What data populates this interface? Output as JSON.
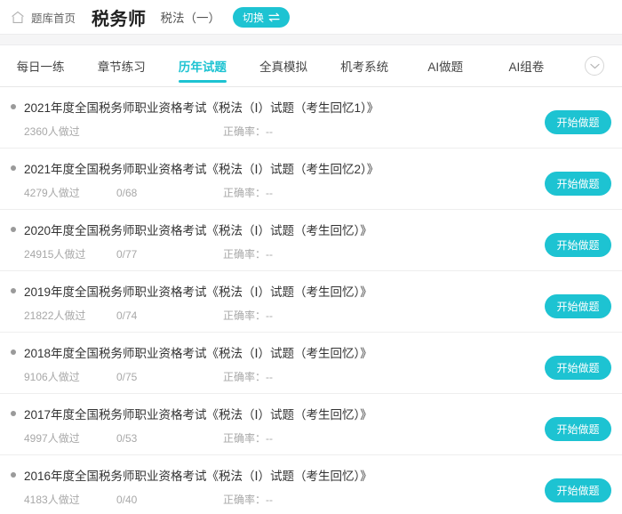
{
  "header": {
    "home_icon": "home-icon",
    "breadcrumb_home": "题库首页",
    "exam_title": "税务师",
    "subject_name": "税法（一）",
    "switch_label": "切换",
    "switch_icon": "swap-horizontal-icon"
  },
  "tabs": {
    "items": [
      {
        "label": "每日一练",
        "active": false
      },
      {
        "label": "章节练习",
        "active": false
      },
      {
        "label": "历年试题",
        "active": true
      },
      {
        "label": "全真模拟",
        "active": false
      },
      {
        "label": "机考系统",
        "active": false
      },
      {
        "label": "AI做题",
        "active": false
      },
      {
        "label": "AI组卷",
        "active": false
      }
    ],
    "more_icon": "chevron-down-icon"
  },
  "list": {
    "start_button_label": "开始做题",
    "rows": [
      {
        "title": "2021年度全国税务师职业资格考试《税法（Ⅰ）试题（考生回忆1）》",
        "users": "2360人做过",
        "progress": "",
        "accuracy": "正确率：--"
      },
      {
        "title": "2021年度全国税务师职业资格考试《税法（Ⅰ）试题（考生回忆2）》",
        "users": "4279人做过",
        "progress": "0/68",
        "accuracy": "正确率：--"
      },
      {
        "title": "2020年度全国税务师职业资格考试《税法（Ⅰ）试题（考生回忆）》",
        "users": "24915人做过",
        "progress": "0/77",
        "accuracy": "正确率：--"
      },
      {
        "title": "2019年度全国税务师职业资格考试《税法（Ⅰ）试题（考生回忆）》",
        "users": "21822人做过",
        "progress": "0/74",
        "accuracy": "正确率：--"
      },
      {
        "title": "2018年度全国税务师职业资格考试《税法（Ⅰ）试题（考生回忆）》",
        "users": "9106人做过",
        "progress": "0/75",
        "accuracy": "正确率：--"
      },
      {
        "title": "2017年度全国税务师职业资格考试《税法（Ⅰ）试题（考生回忆）》",
        "users": "4997人做过",
        "progress": "0/53",
        "accuracy": "正确率：--"
      },
      {
        "title": "2016年度全国税务师职业资格考试《税法（Ⅰ）试题（考生回忆）》",
        "users": "4183人做过",
        "progress": "0/40",
        "accuracy": "正确率：--"
      }
    ]
  },
  "colors": {
    "accent": "#1dc3d2",
    "title_text": "#333333",
    "meta_text": "#a8a8a8",
    "divider": "#eeeeee",
    "band": "#f5f5f6"
  }
}
